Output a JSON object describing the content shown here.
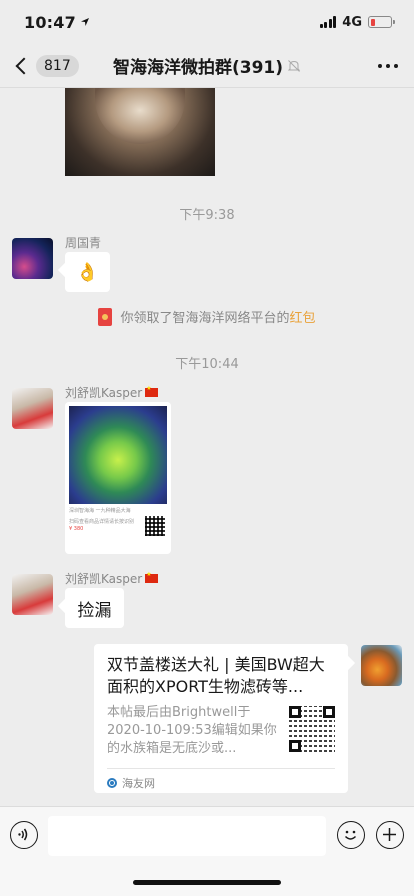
{
  "status_bar": {
    "time": "10:47",
    "network": "4G",
    "battery_color": "#e64340"
  },
  "nav": {
    "unread_count": "817",
    "title": "智海海洋微拍群(391)",
    "icons": [
      "chevron-left-icon",
      "bell-muted-icon",
      "more-icon"
    ]
  },
  "messages": {
    "time_1": "下午9:38",
    "msg1_sender": "周国青",
    "msg1_content": "👌",
    "system_msg_text": "你领取了智海海洋网络平台的",
    "system_msg_link": "红包",
    "time_2": "下午10:44",
    "msg2_sender": "刘舒凯Kasper",
    "msg2_card_text": "深圳智海海 一九种精品大海",
    "msg2_card_sub": "扫码查看商品详情请长按识别",
    "msg2_card_price": "¥ 380",
    "msg3_sender": "刘舒凯Kasper",
    "msg3_content": "捡漏",
    "link_title": "双节盖楼送大礼 | 美国BW超大面积的XPORT生物滤砖等...",
    "link_desc": "本帖最后由Brightwell于2020-10-109:53编辑如果你的水族箱是无底沙或...",
    "link_source": "海友网"
  },
  "input": {
    "placeholder": ""
  },
  "colors": {
    "accent_red": "#e64340",
    "link_orange": "#e9a23b",
    "background": "#ededed"
  }
}
